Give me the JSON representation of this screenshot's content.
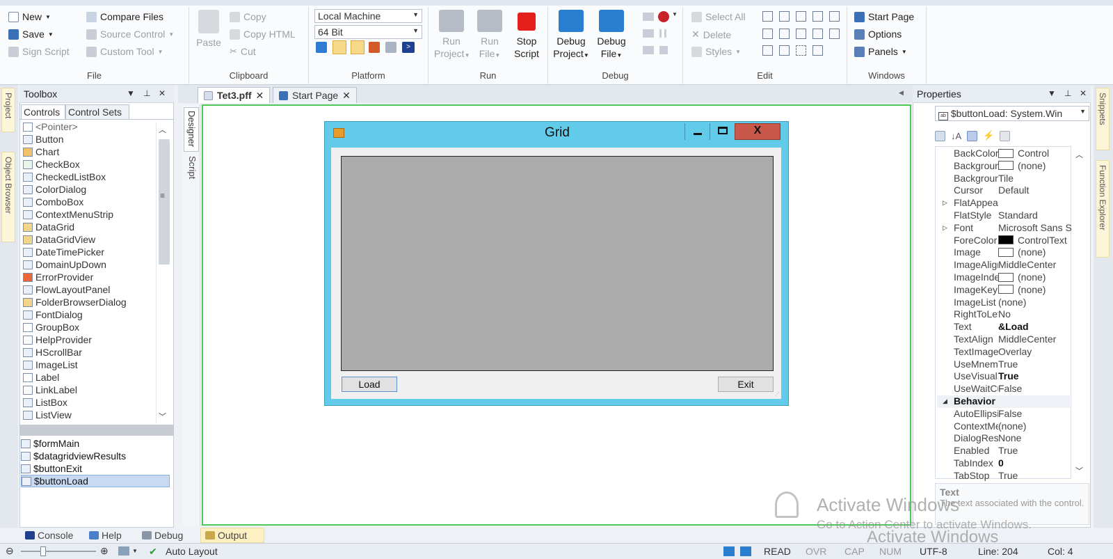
{
  "ribbon": {
    "file": {
      "new_label": "New",
      "save_label": "Save",
      "sign_label": "Sign Script",
      "compare_label": "Compare Files",
      "source_label": "Source Control",
      "custom_label": "Custom Tool",
      "group": "File"
    },
    "clipboard": {
      "paste_label": "Paste",
      "copy_label": "Copy",
      "copy_html_label": "Copy HTML",
      "cut_label": "Cut",
      "group": "Clipboard"
    },
    "platform": {
      "machine": "Local Machine",
      "bits": "64 Bit",
      "group": "Platform"
    },
    "run": {
      "run_project": "Run",
      "run_project2": "Project",
      "run_file": "Run",
      "run_file2": "File",
      "stop": "Stop",
      "stop2": "Script",
      "group": "Run"
    },
    "debug": {
      "debug_project": "Debug",
      "debug_project2": "Project",
      "debug_file": "Debug",
      "debug_file2": "File",
      "group": "Debug"
    },
    "edit": {
      "select_all": "Select All",
      "delete": "Delete",
      "styles": "Styles",
      "group": "Edit"
    },
    "windows": {
      "start_page": "Start Page",
      "options": "Options",
      "panels": "Panels",
      "group": "Windows"
    }
  },
  "side_tabs": {
    "left1": "Project",
    "left2": "Object Browser",
    "right1": "Snippets",
    "right2": "Function Explorer"
  },
  "toolbox": {
    "title": "Toolbox",
    "tab_controls": "Controls",
    "tab_control_sets": "Control Sets",
    "items": [
      "<Pointer>",
      "Button",
      "Chart",
      "CheckBox",
      "CheckedListBox",
      "ColorDialog",
      "ComboBox",
      "ContextMenuStrip",
      "DataGrid",
      "DataGridView",
      "DateTimePicker",
      "DomainUpDown",
      "ErrorProvider",
      "FlowLayoutPanel",
      "FolderBrowserDialog",
      "FontDialog",
      "GroupBox",
      "HelpProvider",
      "HScrollBar",
      "ImageList",
      "Label",
      "LinkLabel",
      "ListBox",
      "ListView"
    ],
    "objects": [
      "$formMain",
      "$datagridviewResults",
      "$buttonExit",
      "$buttonLoad"
    ]
  },
  "doc_tabs": [
    {
      "label": "Tet3.pff"
    },
    {
      "label": "Start Page"
    }
  ],
  "vertical_tabs": {
    "designer": "Designer",
    "script": "Script"
  },
  "form": {
    "title": "Grid",
    "load_label": "Load",
    "exit_label": "Exit"
  },
  "properties": {
    "title": "Properties",
    "selector": "$buttonLoad: System.Win",
    "rows": [
      {
        "name": "BackColor",
        "value": "Control",
        "swatch": "#ffffff"
      },
      {
        "name": "BackgroundImage",
        "value": "(none)",
        "swatch": "#ffffff"
      },
      {
        "name": "BackgroundImageLayout",
        "value": "Tile"
      },
      {
        "name": "Cursor",
        "value": "Default"
      },
      {
        "name": "FlatAppearance",
        "value": "",
        "expand": "▷"
      },
      {
        "name": "FlatStyle",
        "value": "Standard"
      },
      {
        "name": "Font",
        "value": "Microsoft Sans Serif",
        "expand": "▷"
      },
      {
        "name": "ForeColor",
        "value": "ControlText",
        "swatch": "#000000"
      },
      {
        "name": "Image",
        "value": "(none)",
        "swatch": "#ffffff"
      },
      {
        "name": "ImageAlign",
        "value": "MiddleCenter"
      },
      {
        "name": "ImageIndex",
        "value": "(none)",
        "swatch": "#ffffff"
      },
      {
        "name": "ImageKey",
        "value": "(none)",
        "swatch": "#ffffff"
      },
      {
        "name": "ImageList",
        "value": "(none)"
      },
      {
        "name": "RightToLeft",
        "value": "No"
      },
      {
        "name": "Text",
        "value": "&Load",
        "bold": true
      },
      {
        "name": "TextAlign",
        "value": "MiddleCenter"
      },
      {
        "name": "TextImageRelation",
        "value": "Overlay"
      },
      {
        "name": "UseMnemonic",
        "value": "True"
      },
      {
        "name": "UseVisualStyleBackColor",
        "value": "True",
        "bold": true
      },
      {
        "name": "UseWaitCursor",
        "value": "False"
      },
      {
        "name": "Behavior",
        "value": "",
        "category": true,
        "expand": "◢"
      },
      {
        "name": "AutoEllipsis",
        "value": "False"
      },
      {
        "name": "ContextMenuStrip",
        "value": "(none)"
      },
      {
        "name": "DialogResult",
        "value": "None"
      },
      {
        "name": "Enabled",
        "value": "True"
      },
      {
        "name": "TabIndex",
        "value": "0",
        "bold": true
      },
      {
        "name": "TabStop",
        "value": "True"
      }
    ],
    "desc_title": "Text",
    "desc_text": "The text associated with the control."
  },
  "bottom_tabs": [
    "Console",
    "Help",
    "Debug",
    "Output"
  ],
  "status": {
    "auto_layout": "Auto Layout",
    "read": "READ",
    "ovr": "OVR",
    "cap": "CAP",
    "num": "NUM",
    "encoding": "UTF-8",
    "line": "Line: 204",
    "col": "Col: 4"
  },
  "watermark": {
    "title": "Activate Windows",
    "subtitle": "Go to Action Center to activate Windows."
  }
}
